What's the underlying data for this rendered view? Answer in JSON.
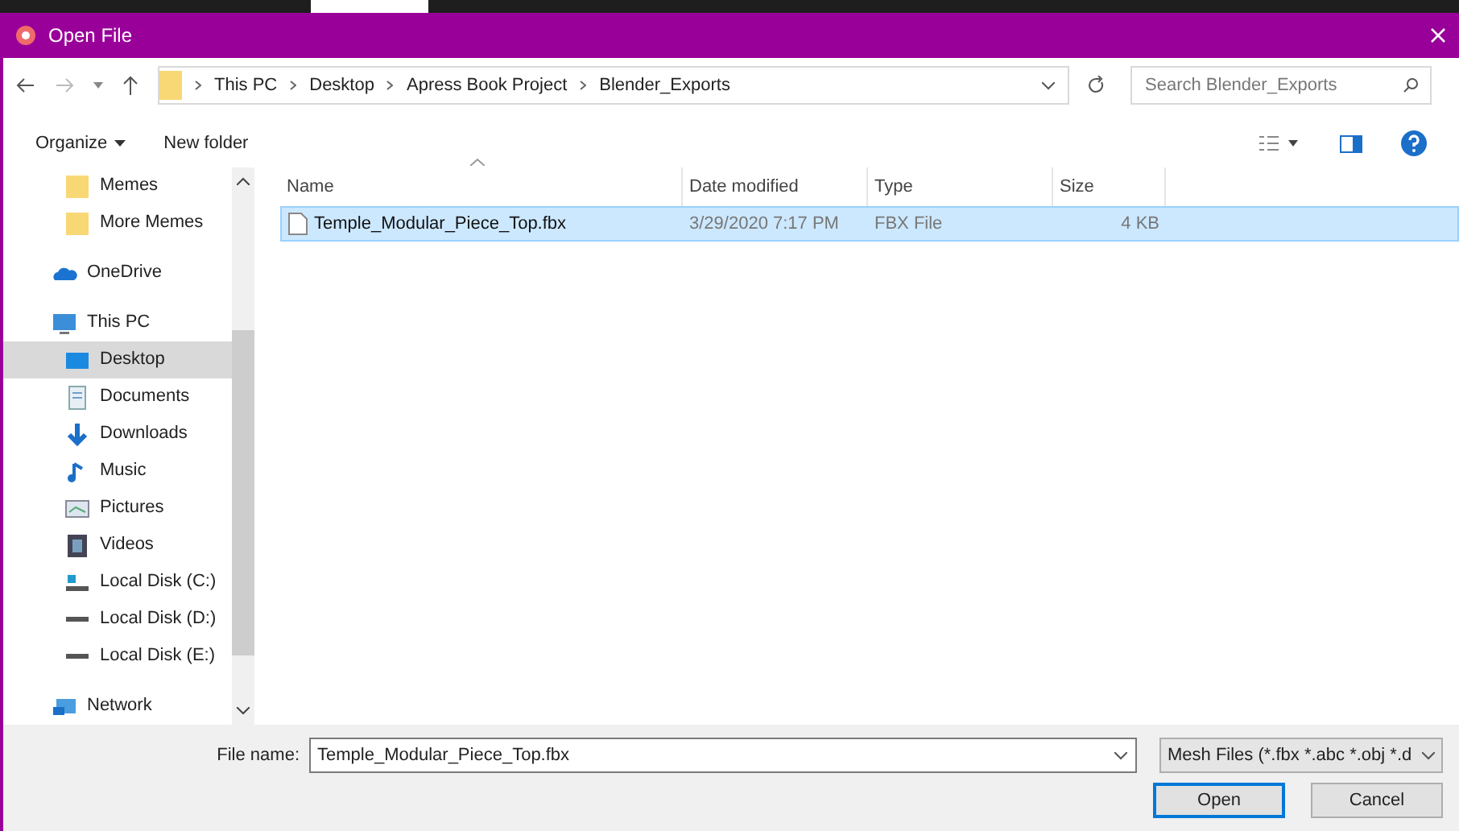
{
  "window": {
    "title": "Open File"
  },
  "breadcrumb": [
    "This PC",
    "Desktop",
    "Apress Book Project",
    "Blender_Exports"
  ],
  "search": {
    "placeholder": "Search Blender_Exports"
  },
  "toolbar": {
    "organize": "Organize",
    "new_folder": "New folder"
  },
  "sidebar": {
    "pinned": [
      {
        "label": "Memes",
        "kind": "folder",
        "selected": false
      },
      {
        "label": "More Memes",
        "kind": "folder",
        "selected": false
      }
    ],
    "items": [
      {
        "label": "OneDrive",
        "kind": "cloud",
        "selected": false
      },
      {
        "label": "This PC",
        "kind": "pc",
        "selected": false,
        "children": [
          {
            "label": "Desktop",
            "kind": "desktop",
            "selected": true
          },
          {
            "label": "Documents",
            "kind": "documents",
            "selected": false
          },
          {
            "label": "Downloads",
            "kind": "downloads",
            "selected": false
          },
          {
            "label": "Music",
            "kind": "music",
            "selected": false
          },
          {
            "label": "Pictures",
            "kind": "pictures",
            "selected": false
          },
          {
            "label": "Videos",
            "kind": "videos",
            "selected": false
          },
          {
            "label": "Local Disk (C:)",
            "kind": "system_disk",
            "selected": false
          },
          {
            "label": "Local Disk (D:)",
            "kind": "disk",
            "selected": false
          },
          {
            "label": "Local Disk (E:)",
            "kind": "disk",
            "selected": false
          }
        ]
      },
      {
        "label": "Network",
        "kind": "network",
        "selected": false
      }
    ]
  },
  "table": {
    "columns": [
      "Name",
      "Date modified",
      "Type",
      "Size"
    ],
    "rows": [
      {
        "name": "Temple_Modular_Piece_Top.fbx",
        "date": "3/29/2020 7:17 PM",
        "type": "FBX File",
        "size": "4 KB",
        "selected": true
      }
    ]
  },
  "footer": {
    "file_name_label": "File name:",
    "file_name": "Temple_Modular_Piece_Top.fbx",
    "filter": "Mesh Files (*.fbx *.abc *.obj *.d",
    "open": "Open",
    "cancel": "Cancel"
  }
}
